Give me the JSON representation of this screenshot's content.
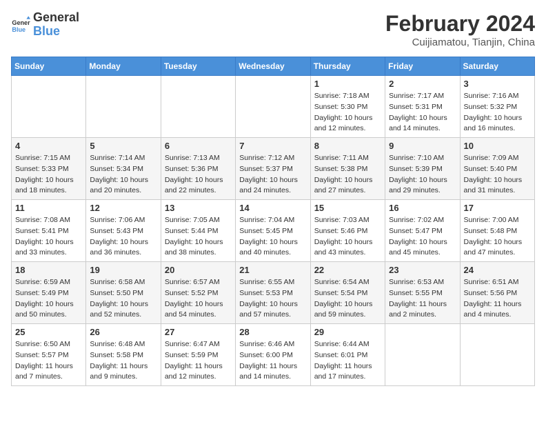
{
  "logo": {
    "line1": "General",
    "line2": "Blue"
  },
  "title": "February 2024",
  "location": "Cuijiamatou, Tianjin, China",
  "weekdays": [
    "Sunday",
    "Monday",
    "Tuesday",
    "Wednesday",
    "Thursday",
    "Friday",
    "Saturday"
  ],
  "weeks": [
    [
      null,
      null,
      null,
      null,
      {
        "day": "1",
        "sunrise": "7:18 AM",
        "sunset": "5:30 PM",
        "daylight": "10 hours and 12 minutes."
      },
      {
        "day": "2",
        "sunrise": "7:17 AM",
        "sunset": "5:31 PM",
        "daylight": "10 hours and 14 minutes."
      },
      {
        "day": "3",
        "sunrise": "7:16 AM",
        "sunset": "5:32 PM",
        "daylight": "10 hours and 16 minutes."
      }
    ],
    [
      {
        "day": "4",
        "sunrise": "7:15 AM",
        "sunset": "5:33 PM",
        "daylight": "10 hours and 18 minutes."
      },
      {
        "day": "5",
        "sunrise": "7:14 AM",
        "sunset": "5:34 PM",
        "daylight": "10 hours and 20 minutes."
      },
      {
        "day": "6",
        "sunrise": "7:13 AM",
        "sunset": "5:36 PM",
        "daylight": "10 hours and 22 minutes."
      },
      {
        "day": "7",
        "sunrise": "7:12 AM",
        "sunset": "5:37 PM",
        "daylight": "10 hours and 24 minutes."
      },
      {
        "day": "8",
        "sunrise": "7:11 AM",
        "sunset": "5:38 PM",
        "daylight": "10 hours and 27 minutes."
      },
      {
        "day": "9",
        "sunrise": "7:10 AM",
        "sunset": "5:39 PM",
        "daylight": "10 hours and 29 minutes."
      },
      {
        "day": "10",
        "sunrise": "7:09 AM",
        "sunset": "5:40 PM",
        "daylight": "10 hours and 31 minutes."
      }
    ],
    [
      {
        "day": "11",
        "sunrise": "7:08 AM",
        "sunset": "5:41 PM",
        "daylight": "10 hours and 33 minutes."
      },
      {
        "day": "12",
        "sunrise": "7:06 AM",
        "sunset": "5:43 PM",
        "daylight": "10 hours and 36 minutes."
      },
      {
        "day": "13",
        "sunrise": "7:05 AM",
        "sunset": "5:44 PM",
        "daylight": "10 hours and 38 minutes."
      },
      {
        "day": "14",
        "sunrise": "7:04 AM",
        "sunset": "5:45 PM",
        "daylight": "10 hours and 40 minutes."
      },
      {
        "day": "15",
        "sunrise": "7:03 AM",
        "sunset": "5:46 PM",
        "daylight": "10 hours and 43 minutes."
      },
      {
        "day": "16",
        "sunrise": "7:02 AM",
        "sunset": "5:47 PM",
        "daylight": "10 hours and 45 minutes."
      },
      {
        "day": "17",
        "sunrise": "7:00 AM",
        "sunset": "5:48 PM",
        "daylight": "10 hours and 47 minutes."
      }
    ],
    [
      {
        "day": "18",
        "sunrise": "6:59 AM",
        "sunset": "5:49 PM",
        "daylight": "10 hours and 50 minutes."
      },
      {
        "day": "19",
        "sunrise": "6:58 AM",
        "sunset": "5:50 PM",
        "daylight": "10 hours and 52 minutes."
      },
      {
        "day": "20",
        "sunrise": "6:57 AM",
        "sunset": "5:52 PM",
        "daylight": "10 hours and 54 minutes."
      },
      {
        "day": "21",
        "sunrise": "6:55 AM",
        "sunset": "5:53 PM",
        "daylight": "10 hours and 57 minutes."
      },
      {
        "day": "22",
        "sunrise": "6:54 AM",
        "sunset": "5:54 PM",
        "daylight": "10 hours and 59 minutes."
      },
      {
        "day": "23",
        "sunrise": "6:53 AM",
        "sunset": "5:55 PM",
        "daylight": "11 hours and 2 minutes."
      },
      {
        "day": "24",
        "sunrise": "6:51 AM",
        "sunset": "5:56 PM",
        "daylight": "11 hours and 4 minutes."
      }
    ],
    [
      {
        "day": "25",
        "sunrise": "6:50 AM",
        "sunset": "5:57 PM",
        "daylight": "11 hours and 7 minutes."
      },
      {
        "day": "26",
        "sunrise": "6:48 AM",
        "sunset": "5:58 PM",
        "daylight": "11 hours and 9 minutes."
      },
      {
        "day": "27",
        "sunrise": "6:47 AM",
        "sunset": "5:59 PM",
        "daylight": "11 hours and 12 minutes."
      },
      {
        "day": "28",
        "sunrise": "6:46 AM",
        "sunset": "6:00 PM",
        "daylight": "11 hours and 14 minutes."
      },
      {
        "day": "29",
        "sunrise": "6:44 AM",
        "sunset": "6:01 PM",
        "daylight": "11 hours and 17 minutes."
      },
      null,
      null
    ]
  ]
}
